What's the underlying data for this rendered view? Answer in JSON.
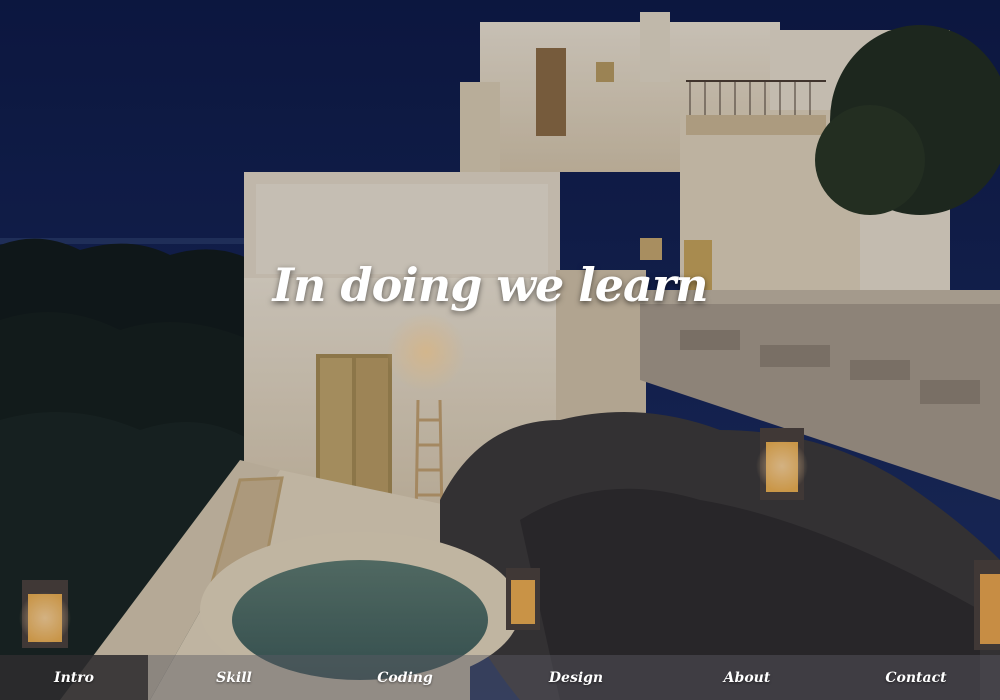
{
  "hero": {
    "title": "In doing we learn"
  },
  "nav": {
    "items": [
      {
        "label": "Intro",
        "active": true
      },
      {
        "label": "Skill",
        "active": false
      },
      {
        "label": "Coding",
        "active": false
      },
      {
        "label": "Design",
        "active": false
      },
      {
        "label": "About",
        "active": false
      },
      {
        "label": "Contact",
        "active": false
      }
    ]
  },
  "colors": {
    "sky": "#0d1a44",
    "building": "#e8dcc4",
    "lamp": "#f2b24a",
    "nav_active": "#2a272a"
  }
}
